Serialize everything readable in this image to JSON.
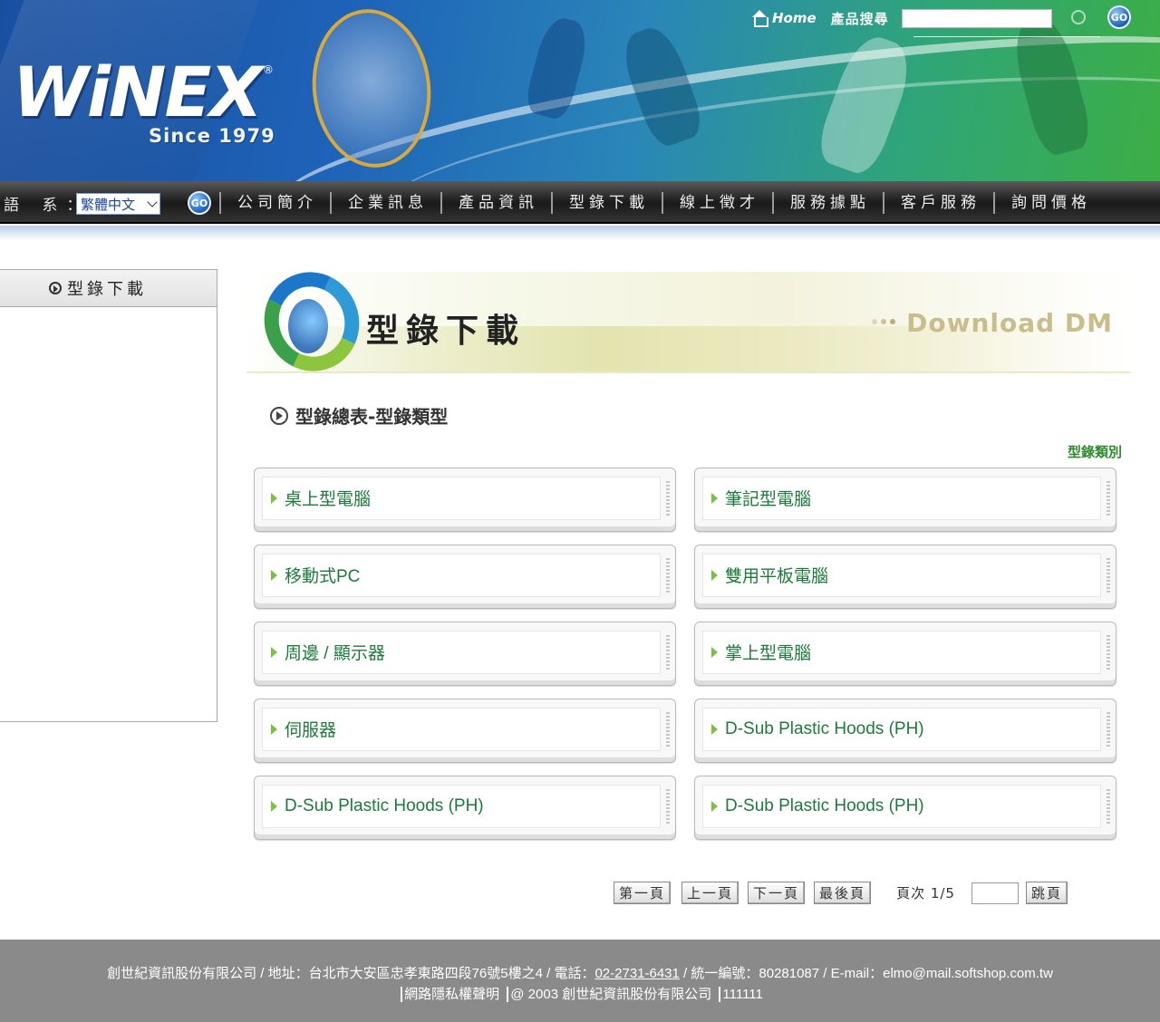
{
  "header": {
    "logo_text": "WiNEX",
    "logo_reg": "®",
    "logo_since": "Since 1979",
    "home_label": "Home",
    "search_label": "產品搜尋",
    "search_value": "",
    "go_label": "GO"
  },
  "nav": {
    "lang_label": "語 系：",
    "lang_selected": "繁體中文",
    "go_label": "GO",
    "items": [
      "公司簡介",
      "企業訊息",
      "產品資訊",
      "型錄下載",
      "線上徵才",
      "服務據點",
      "客戶服務",
      "詢問價格"
    ]
  },
  "sidebar": {
    "title": "型錄下載"
  },
  "banner": {
    "title_cn": "型錄下載",
    "title_en": "Download DM"
  },
  "section": {
    "title": "型錄總表-型錄類型",
    "category_label": "型錄類別"
  },
  "cards": [
    "桌上型電腦",
    "筆記型電腦",
    "移動式PC",
    "雙用平板電腦",
    "周邊 / 顯示器",
    "掌上型電腦",
    "伺服器",
    "D-Sub Plastic Hoods (PH)",
    "D-Sub Plastic Hoods (PH)",
    "D-Sub Plastic Hoods (PH)"
  ],
  "pager": {
    "first": "第一頁",
    "prev": "上一頁",
    "next": "下一頁",
    "last": "最後頁",
    "page_text": "頁次 1/5",
    "jump_value": "",
    "jump": "跳頁"
  },
  "footer": {
    "line1_prefix": "創世紀資訊股份有限公司 / 地址：台北市大安區忠孝東路四段76號5樓之4 / 電話：",
    "phone": "02-2731-6431",
    "line1_suffix": " / 統一編號：80281087 / E-mail：elmo@mail.softshop.com.tw",
    "privacy": "網路隱私權聲明",
    "copyright": "@ 2003 創世紀資訊股份有限公司",
    "counter": "111111"
  }
}
